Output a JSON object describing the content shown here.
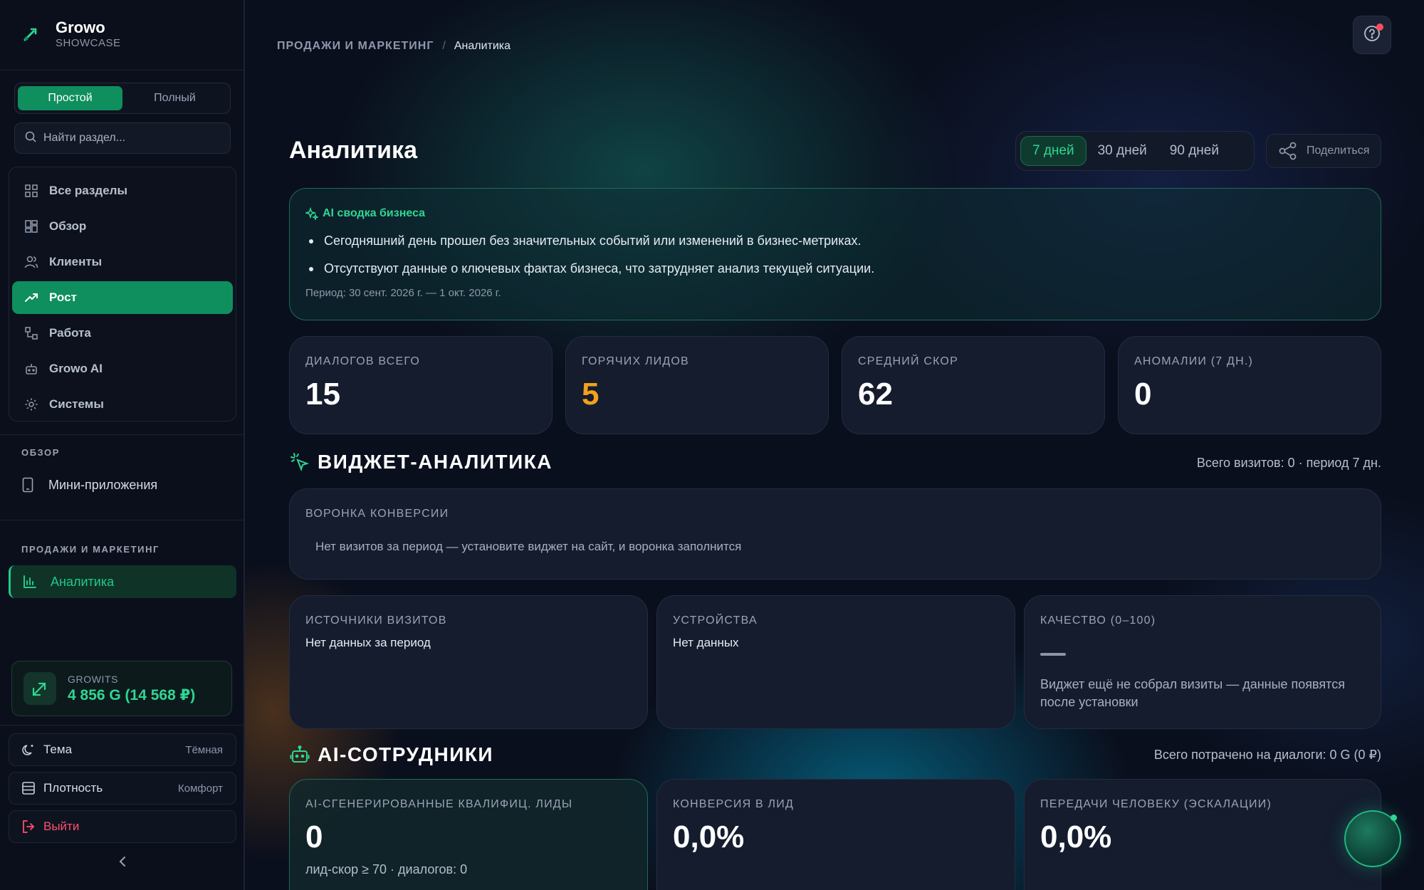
{
  "brand": {
    "name": "Growo",
    "subtitle": "SHOWCASE"
  },
  "sidebar": {
    "mode_toggle": {
      "simple": "Простой",
      "full": "Полный",
      "active": "simple"
    },
    "search": {
      "placeholder": "Найти раздел..."
    },
    "nav": [
      {
        "label": "Все разделы",
        "icon": "grid-icon",
        "active": false
      },
      {
        "label": "Обзор",
        "icon": "dashboard-icon",
        "active": false
      },
      {
        "label": "Клиенты",
        "icon": "users-icon",
        "active": false
      },
      {
        "label": "Рост",
        "icon": "trending-up-icon",
        "active": true
      },
      {
        "label": "Работа",
        "icon": "workflow-icon",
        "active": false
      },
      {
        "label": "Growo AI",
        "icon": "robot-icon",
        "active": false
      },
      {
        "label": "Системы",
        "icon": "gear-icon",
        "active": false
      }
    ],
    "overview_section": {
      "title": "ОБЗОР",
      "items": [
        {
          "label": "Мини-приложения",
          "icon": "phone-icon"
        }
      ]
    },
    "sales_section": {
      "title": "ПРОДАЖИ И МАРКЕТИНГ",
      "items": [
        {
          "label": "Аналитика",
          "icon": "bar-chart-icon",
          "active": true
        }
      ]
    },
    "growits": {
      "label": "GROWITS",
      "value": "4 856 G (14 568 ₽)"
    },
    "settings": {
      "theme": {
        "label": "Тема",
        "value": "Тёмная"
      },
      "density": {
        "label": "Плотность",
        "value": "Комфорт"
      },
      "logout": {
        "label": "Выйти"
      }
    },
    "collapse_icon": "chevron-left-icon"
  },
  "header": {
    "breadcrumb": {
      "parent": "ПРОДАЖИ И МАРКЕТИНГ",
      "separator": "/",
      "current": "Аналитика"
    },
    "help_icon": "help-icon"
  },
  "page": {
    "title": "Аналитика",
    "ranges": [
      {
        "label": "7 дней",
        "active": true
      },
      {
        "label": "30 дней",
        "active": false
      },
      {
        "label": "90 дней",
        "active": false
      }
    ],
    "share_label": "Поделиться"
  },
  "ai_summary": {
    "title": "AI сводка бизнеса",
    "bullets": [
      "Сегодняшний день прошел без значительных событий или изменений в бизнес-метриках.",
      "Отсутствуют данные о ключевых фактах бизнеса, что затрудняет анализ текущей ситуации."
    ],
    "period": "Период: 30 сент. 2026 г. — 1 окт. 2026 г."
  },
  "kpis": [
    {
      "label": "ДИАЛОГОВ ВСЕГО",
      "value": "15"
    },
    {
      "label": "ГОРЯЧИХ ЛИДОВ",
      "value": "5",
      "color": "#f2a01e"
    },
    {
      "label": "СРЕДНИЙ СКОР",
      "value": "62"
    },
    {
      "label": "АНОМАЛИИ (7 ДН.)",
      "value": "0"
    }
  ],
  "widget_section": {
    "title": "ВИДЖЕТ-АНАЛИТИКА",
    "meta": "Всего визитов: 0 · период 7 дн.",
    "funnel": {
      "label": "ВОРОНКА КОНВЕРСИИ",
      "text": "Нет визитов за период — установите виджет на сайт, и воронка заполнится"
    },
    "sources": {
      "label": "ИСТОЧНИКИ ВИЗИТОВ",
      "text": "Нет данных за период"
    },
    "devices": {
      "label": "УСТРОЙСТВА",
      "text": "Нет данных"
    },
    "quality": {
      "label": "КАЧЕСТВО (0–100)",
      "value": "—",
      "text": "Виджет ещё не собрал визиты — данные появятся после установки"
    }
  },
  "ai_section": {
    "title": "AI-СОТРУДНИКИ",
    "meta": "Всего потрачено на диалоги: 0 G (0 ₽)",
    "cards": [
      {
        "label": "AI-СГЕНЕРИРОВАННЫЕ КВАЛИФИЦ. ЛИДЫ",
        "value": "0",
        "sub": "лид-скор ≥ 70 · диалогов: 0"
      },
      {
        "label": "КОНВЕРСИЯ В ЛИД",
        "value": "0,0%"
      },
      {
        "label": "ПЕРЕДАЧИ ЧЕЛОВЕКУ (ЭСКАЛАЦИИ)",
        "value": "0,0%"
      }
    ]
  },
  "colors": {
    "accent": "#0f8f5e",
    "accent_text": "#2fd693",
    "hot_leads": "#f2a01e",
    "logout": "#ff4f6d"
  }
}
